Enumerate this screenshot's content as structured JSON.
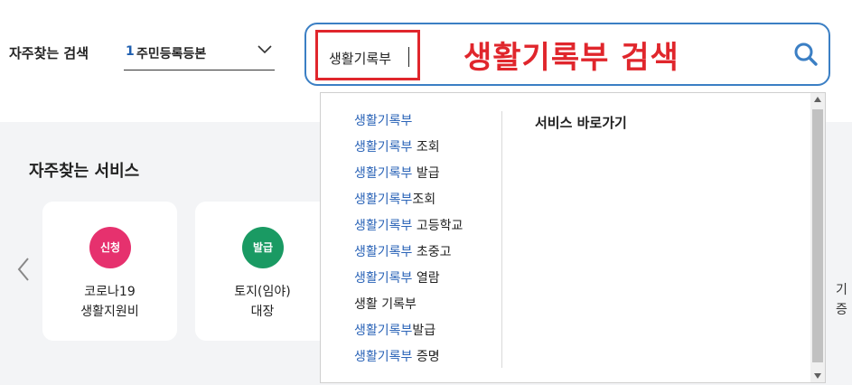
{
  "top": {
    "frequent_label": "자주찾는 검색",
    "frequent_select": {
      "number": "1",
      "text": "주민등록등본"
    }
  },
  "search": {
    "value": "생활기록부",
    "annotation": "생활기록부 검색",
    "button_icon": "search-icon"
  },
  "dropdown": {
    "suggestions": [
      {
        "hl": "생활기록부",
        "rest": ""
      },
      {
        "hl": "생활기록부",
        "rest": " 조회"
      },
      {
        "hl": "생활기록부",
        "rest": " 발급"
      },
      {
        "hl": "생활기록부",
        "rest": "조회"
      },
      {
        "hl": "생활기록부",
        "rest": " 고등학교"
      },
      {
        "hl": "생활기록부",
        "rest": " 초중고"
      },
      {
        "hl": "생활기록부",
        "rest": " 열람"
      },
      {
        "hl": "",
        "rest": "생활 기록부"
      },
      {
        "hl": "생활기록부",
        "rest": "발급"
      },
      {
        "hl": "생활기록부",
        "rest": " 증명"
      }
    ],
    "shortcut_title": "서비스 바로가기"
  },
  "services": {
    "title": "자주찾는 서비스",
    "cards": [
      {
        "badge": "신청",
        "line1": "코로나19",
        "line2": "생활지원비"
      },
      {
        "badge": "발급",
        "line1": "토지(임야)",
        "line2": "대장"
      }
    ],
    "partial_line1": "기",
    "partial_line2": "증"
  },
  "colors": {
    "accent_blue": "#3b7fc4",
    "highlight_red": "#e0262c",
    "badge_pink": "#e6316e",
    "badge_green": "#1a9a63",
    "suggestion_blue": "#2a63b7"
  }
}
